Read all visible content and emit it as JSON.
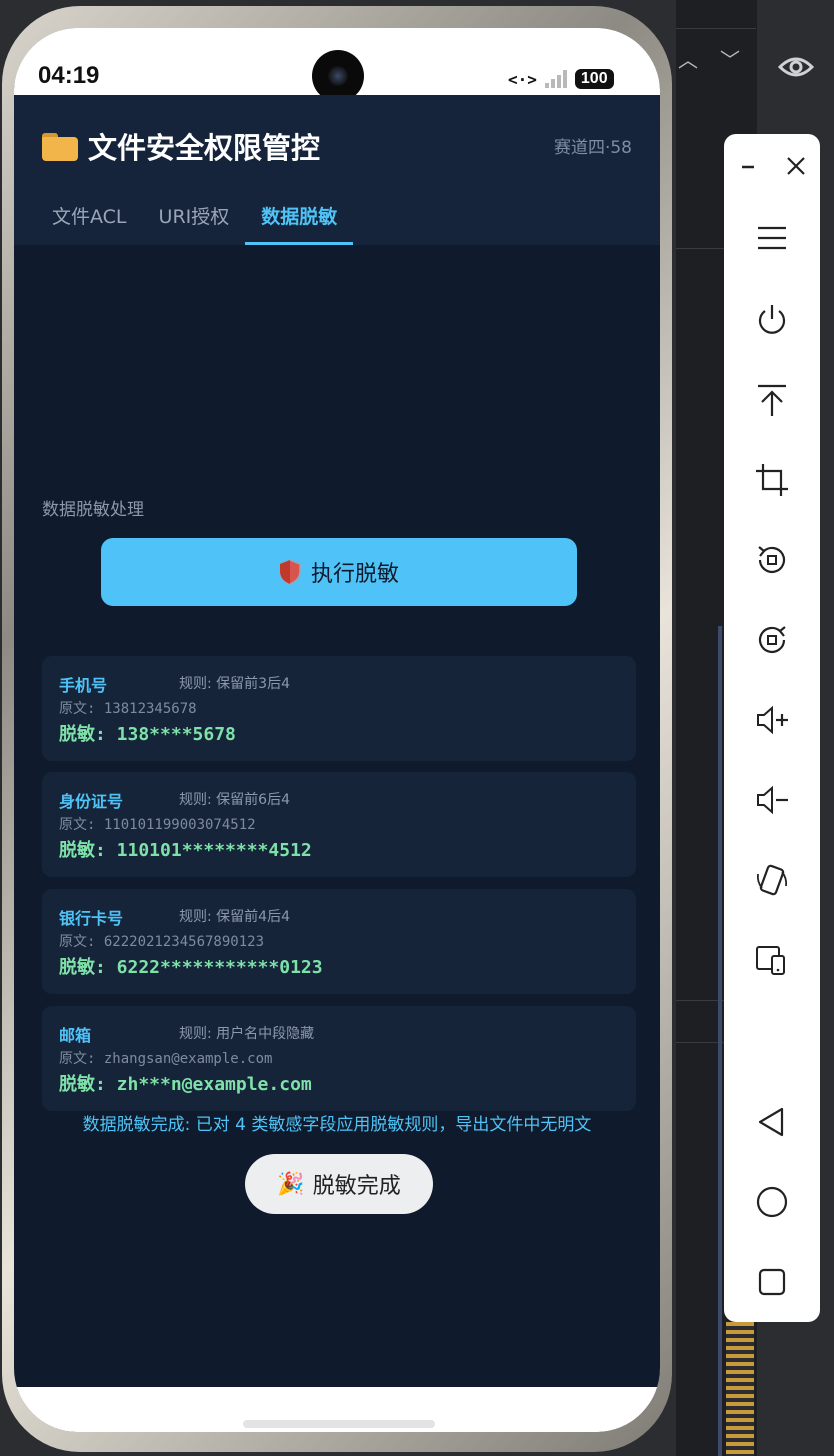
{
  "statusbar": {
    "time": "04:19",
    "net": "<·>",
    "battery": "100"
  },
  "app": {
    "title": "文件安全权限管控",
    "subtitle": "赛道四·58",
    "tabs": [
      {
        "label": "文件ACL",
        "active": false
      },
      {
        "label": "URI授权",
        "active": false
      },
      {
        "label": "数据脱敏",
        "active": true
      }
    ],
    "section_label": "数据脱敏处理",
    "run_button": "执行脱敏",
    "cards": [
      {
        "name": "手机号",
        "rule": "规则: 保留前3后4",
        "original": "原文: 13812345678",
        "masked": "脱敏: 138****5678"
      },
      {
        "name": "身份证号",
        "rule": "规则: 保留前6后4",
        "original": "原文: 110101199003074512",
        "masked": "脱敏: 110101********4512"
      },
      {
        "name": "银行卡号",
        "rule": "规则: 保留前4后4",
        "original": "原文: 6222021234567890123",
        "masked": "脱敏: 6222***********0123"
      },
      {
        "name": "邮箱",
        "rule": "规则: 用户名中段隐藏",
        "original": "原文: zhangsan@example.com",
        "masked": "脱敏: zh***n@example.com"
      }
    ],
    "result_text": "数据脱敏完成: 已对 4 类敏感字段应用脱敏规则，导出文件中无明文",
    "toast": "脱敏完成"
  },
  "colors": {
    "accent": "#4fc3f7",
    "masked_text": "#7ee2a8",
    "app_bg": "#0f1b2c",
    "card_bg": "#16243a"
  },
  "toolbar": {
    "icons": [
      "minimize-icon",
      "close-icon",
      "menu-icon",
      "power-icon",
      "rotate-top-icon",
      "crop-icon",
      "rotate-left-icon",
      "rotate-right-icon",
      "volume-up-icon",
      "volume-down-icon",
      "fold-icon",
      "device-icon",
      "back-icon",
      "home-icon",
      "overview-icon"
    ]
  }
}
